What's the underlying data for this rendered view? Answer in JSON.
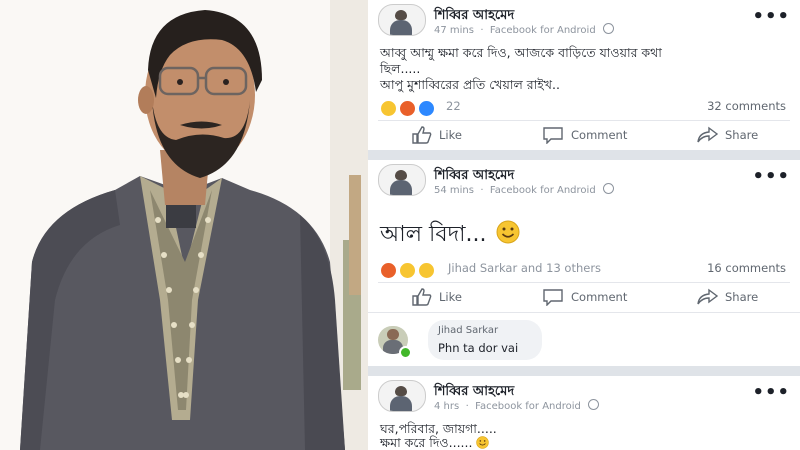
{
  "posts": [
    {
      "author": "শিব্বির আহমেদ",
      "time": "47 mins",
      "via": "Facebook for Android",
      "text_lines": [
        "আব্বু আম্মু ক্ষমা করে দিও, আজকে বাড়িতে যাওয়ার কথা",
        "ছিল.....",
        "আপু মুশাব্বিরের প্রতি খেয়াল রাইখ.."
      ],
      "reaction_count": "22",
      "comments": "32 comments",
      "actions": {
        "like": "Like",
        "comment": "Comment",
        "share": "Share"
      }
    },
    {
      "author": "শিব্বির আহমেদ",
      "time": "54 mins",
      "via": "Facebook for Android",
      "text": "আল বিদা...",
      "reaction_summary": "Jihad Sarkar and 13 others",
      "comments": "16 comments",
      "actions": {
        "like": "Like",
        "comment": "Comment",
        "share": "Share"
      },
      "top_comment": {
        "author": "Jihad Sarkar",
        "text": "Phn ta dor vai"
      }
    },
    {
      "author": "শিব্বির আহমেদ",
      "time": "4 hrs",
      "via": "Facebook for Android",
      "text_lines": [
        "ঘর,পরিবার, জায়গা.....",
        "ক্ষমা করে দিও......"
      ]
    }
  ],
  "colors": {
    "feed_bg": "#dfe3e8",
    "card_bg": "#ffffff",
    "text": "#1d2129",
    "muted": "#8d949e",
    "online": "#42b72a"
  }
}
